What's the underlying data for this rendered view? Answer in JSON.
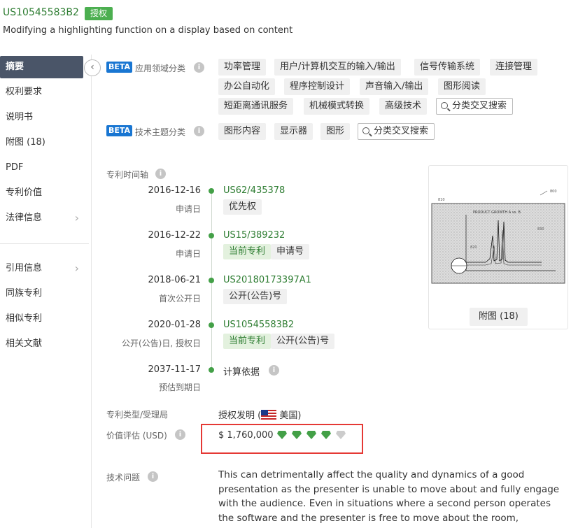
{
  "header": {
    "patent_number": "US10545583B2",
    "status": "授权",
    "title": "Modifying a highlighting function on a display based on content"
  },
  "sidebar": {
    "items": [
      {
        "label": "摘要",
        "active": true
      },
      {
        "label": "权利要求"
      },
      {
        "label": "说明书"
      },
      {
        "label": "附图 (18)"
      },
      {
        "label": "PDF"
      },
      {
        "label": "专利价值"
      },
      {
        "label": "法律信息",
        "has_chevron": true
      },
      {
        "label": "引用信息",
        "has_chevron": true
      },
      {
        "label": "同族专利"
      },
      {
        "label": "相似专利"
      },
      {
        "label": "相关文献"
      }
    ],
    "collapse_icon": "chevron-left-icon"
  },
  "classification": {
    "beta_label": "BETA",
    "application_label": "应用领域分类",
    "application_tags": [
      "功率管理",
      "用户/计算机交互的输入/输出",
      "信号传输系统",
      "连接管理",
      "办公自动化",
      "程序控制设计",
      "声音输入/输出",
      "图形阅读",
      "短距离通讯服务",
      "机械模式转换",
      "高级技术"
    ],
    "tech_label": "技术主题分类",
    "tech_tags": [
      "图形内容",
      "显示器",
      "图形"
    ],
    "cross_search": "分类交叉搜索"
  },
  "timeline": {
    "label": "专利时间轴",
    "events": [
      {
        "date": "2016-12-16",
        "type": "申请日",
        "link": "US62/435378",
        "tags": [
          "优先权"
        ]
      },
      {
        "date": "2016-12-22",
        "type": "申请日",
        "link": "US15/389232",
        "tags": [
          "当前专利",
          "申请号"
        ]
      },
      {
        "date": "2018-06-21",
        "type": "首次公开日",
        "link": "US20180173397A1",
        "tags": [
          "公开(公告)号"
        ]
      },
      {
        "date": "2020-01-28",
        "type": "公开(公告)日, 授权日",
        "link": "US10545583B2",
        "tags": [
          "当前专利",
          "公开(公告)号"
        ]
      },
      {
        "date": "2037-11-17",
        "type": "预估到期日",
        "link": "计算依据",
        "tags": []
      }
    ]
  },
  "drawing": {
    "title": "PRODUCT GROWTH  A vs. B",
    "ref_800": "800",
    "ref_810": "810",
    "ref_820": "820",
    "ref_830": "830",
    "button": "附图 (18)"
  },
  "patent_type": {
    "label": "专利类型/受理局",
    "value": "授权发明",
    "country_open": "(",
    "country": "美国",
    "country_close": ")"
  },
  "valuation": {
    "label": "价值评估 (USD)",
    "value": "$ 1,760,000",
    "gems_filled": 4,
    "gems_total": 5,
    "gem_color": "#43a047",
    "gem_empty_color": "#cccccc"
  },
  "tech_problem": {
    "label": "技术问题",
    "text": "This can detrimentally affect the quality and dynamics of a good presentation as the presenter is unable to move about and fully engage with the audience. Even in situations where a second person operates the software and the presenter is free to move about the room, constantly having to remind the"
  }
}
